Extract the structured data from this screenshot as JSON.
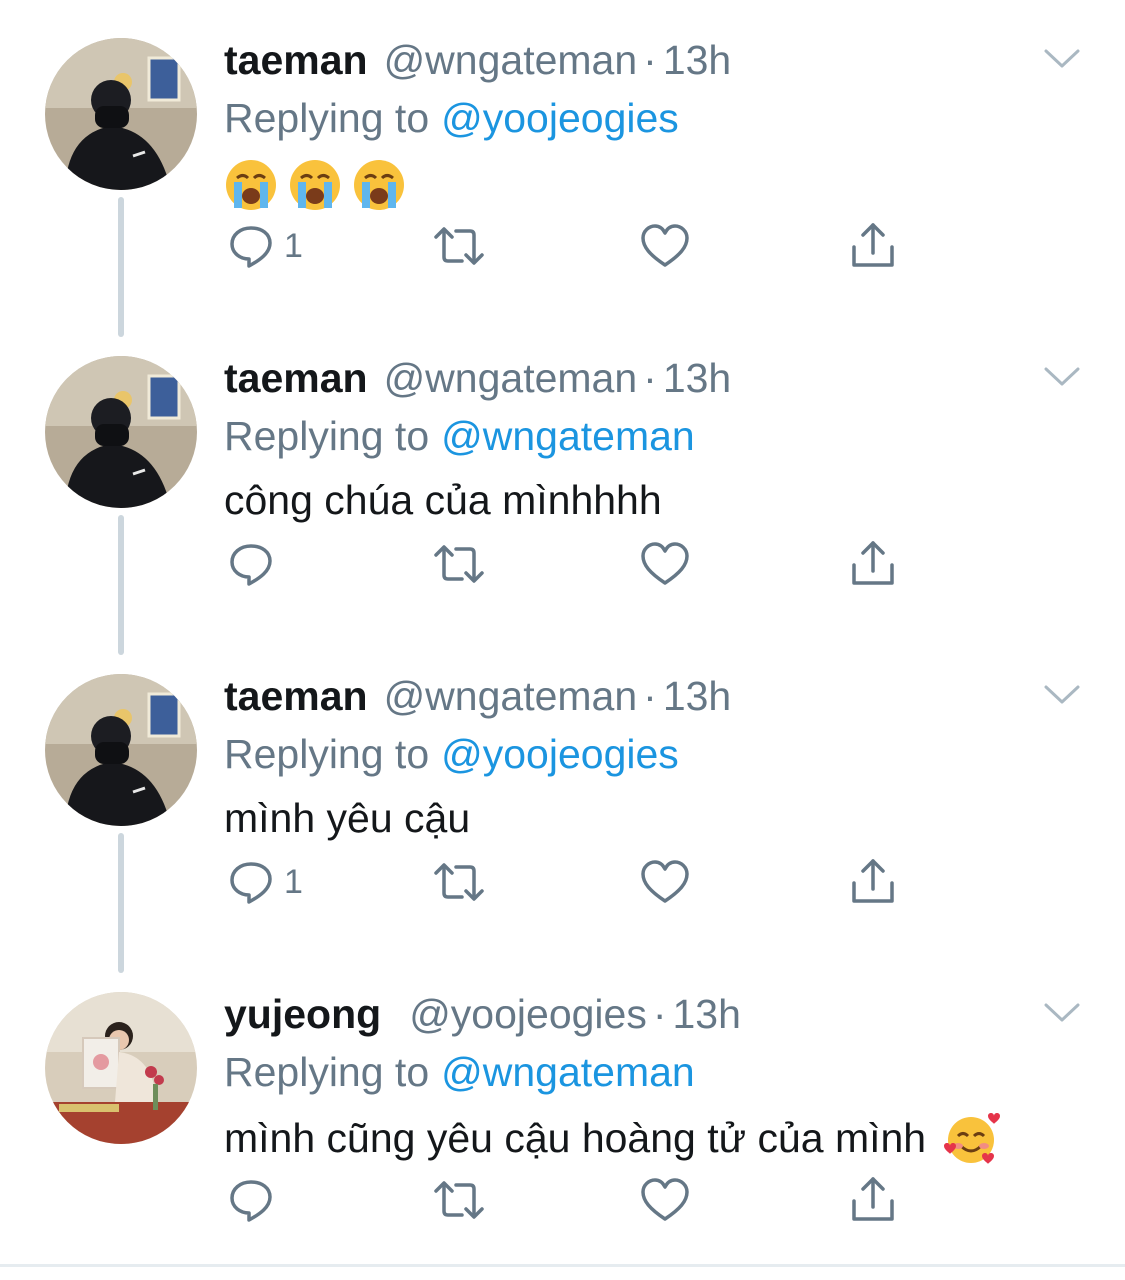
{
  "tweets": [
    {
      "name": "taeman",
      "handle": "@wngateman",
      "dot": "·",
      "time": "13h",
      "replying_prefix": "Replying to",
      "replying_to": "@yoojeogies",
      "text": "",
      "emojis": [
        "loudly-crying-face",
        "loudly-crying-face",
        "loudly-crying-face"
      ],
      "reply_count": "1",
      "avatar": "taeman-avatar"
    },
    {
      "name": "taeman",
      "handle": "@wngateman",
      "dot": "·",
      "time": "13h",
      "replying_prefix": "Replying to",
      "replying_to": "@wngateman",
      "text": "công chúa của mìnhhhh",
      "emojis": [],
      "reply_count": "",
      "avatar": "taeman-avatar"
    },
    {
      "name": "taeman",
      "handle": "@wngateman",
      "dot": "·",
      "time": "13h",
      "replying_prefix": "Replying to",
      "replying_to": "@yoojeogies",
      "text": "mình yêu cậu",
      "emojis": [],
      "reply_count": "1",
      "avatar": "taeman-avatar"
    },
    {
      "name": "yujeong",
      "handle": "@yoojeogies",
      "dot": "·",
      "time": "13h",
      "replying_prefix": "Replying to",
      "replying_to": "@wngateman",
      "text": "mình cũng yêu cậu hoàng tử của mình",
      "emojis": [
        "smiling-face-with-hearts"
      ],
      "reply_count": "",
      "avatar": "yujeong-avatar"
    }
  ],
  "icons": {
    "reply": "reply-icon",
    "retweet": "retweet-icon",
    "like": "heart-icon",
    "share": "share-icon",
    "menu": "chevron-down-icon"
  },
  "colors": {
    "text": "#14171a",
    "secondary": "#657786",
    "link": "#1b95e0",
    "icon": "#657786",
    "thread_line": "#ccd6dd"
  }
}
